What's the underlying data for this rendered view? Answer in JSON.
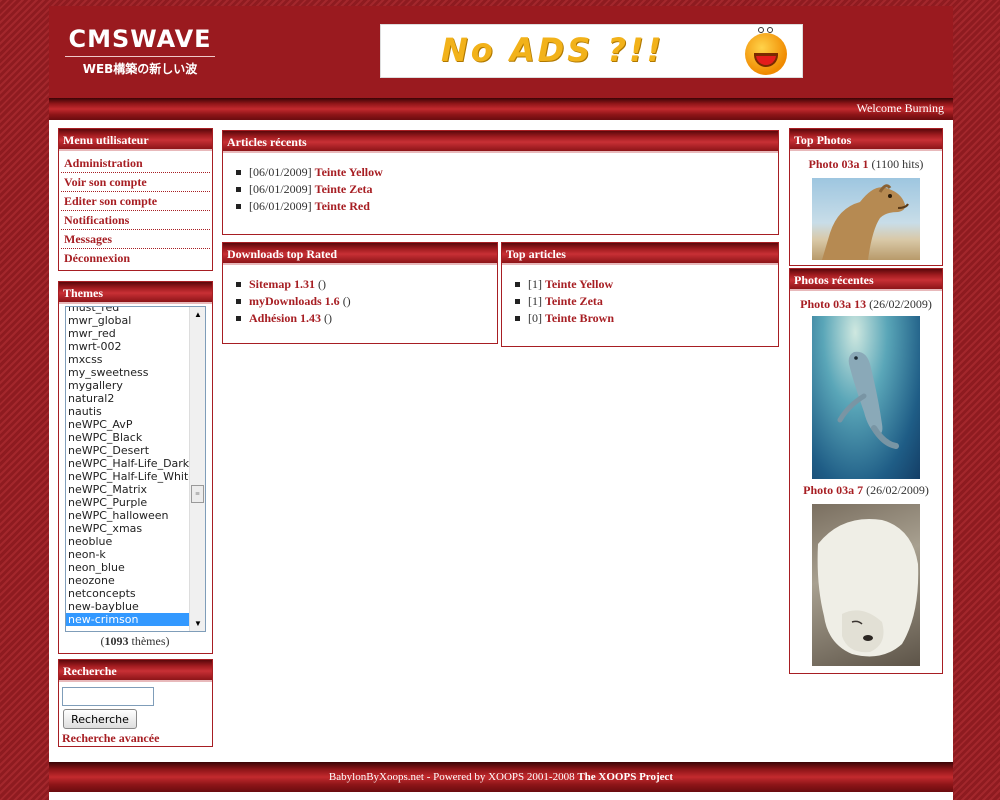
{
  "header": {
    "logo_main": "CMSWAVE",
    "logo_sub": "WEB構築の新しい波",
    "banner_text": "No ADS ?!!",
    "welcome": "Welcome Burning"
  },
  "user_menu": {
    "title": "Menu utilisateur",
    "items": [
      "Administration",
      "Voir son compte",
      "Editer son compte",
      "Notifications",
      "Messages",
      "Déconnexion"
    ]
  },
  "themes": {
    "title": "Themes",
    "options": [
      "must_red",
      "mwr_global",
      "mwr_red",
      "mwrt-002",
      "mxcss",
      "my_sweetness",
      "mygallery",
      "natural2",
      "nautis",
      "neWPC_AvP",
      "neWPC_Black",
      "neWPC_Desert",
      "neWPC_Half-Life_Dark",
      "neWPC_Half-Life_White",
      "neWPC_Matrix",
      "neWPC_Purple",
      "neWPC_halloween",
      "neWPC_xmas",
      "neoblue",
      "neon-k",
      "neon_blue",
      "neozone",
      "netconcepts",
      "new-bayblue",
      "new-crimson"
    ],
    "selected": "new-crimson",
    "count": "1093",
    "count_suffix": " thèmes)",
    "count_prefix": "("
  },
  "search": {
    "title": "Recherche",
    "button": "Recherche",
    "advanced": "Recherche avancée",
    "value": ""
  },
  "recent_articles": {
    "title": "Articles récents",
    "items": [
      {
        "date": "[06/01/2009]",
        "link": "Teinte Yellow"
      },
      {
        "date": "[06/01/2009]",
        "link": "Teinte Zeta"
      },
      {
        "date": "[06/01/2009]",
        "link": "Teinte Red"
      }
    ]
  },
  "downloads": {
    "title": "Downloads top Rated",
    "items": [
      {
        "link": "Sitemap 1.31",
        "suffix": " ()"
      },
      {
        "link": "myDownloads 1.6",
        "suffix": " ()"
      },
      {
        "link": "Adhésion 1.43",
        "suffix": " ()"
      }
    ]
  },
  "top_articles": {
    "title": "Top articles",
    "items": [
      {
        "rank": "[1]",
        "link": "Teinte Yellow"
      },
      {
        "rank": "[1]",
        "link": "Teinte Zeta"
      },
      {
        "rank": "[0]",
        "link": "Teinte Brown"
      }
    ]
  },
  "top_photos": {
    "title": "Top Photos",
    "items": [
      {
        "link": "Photo 03a 1",
        "meta": " (1100 hits)"
      }
    ]
  },
  "recent_photos": {
    "title": "Photos récentes",
    "items": [
      {
        "link": "Photo 03a 13",
        "meta": " (26/02/2009)"
      },
      {
        "link": "Photo 03a 7",
        "meta": " (26/02/2009)"
      }
    ]
  },
  "footer": {
    "text": "BabylonByXoops.net - Powered by XOOPS 2001-2008 ",
    "project": "The XOOPS Project"
  },
  "colors": {
    "brand": "#a71e23",
    "background": "#9a1f24"
  }
}
